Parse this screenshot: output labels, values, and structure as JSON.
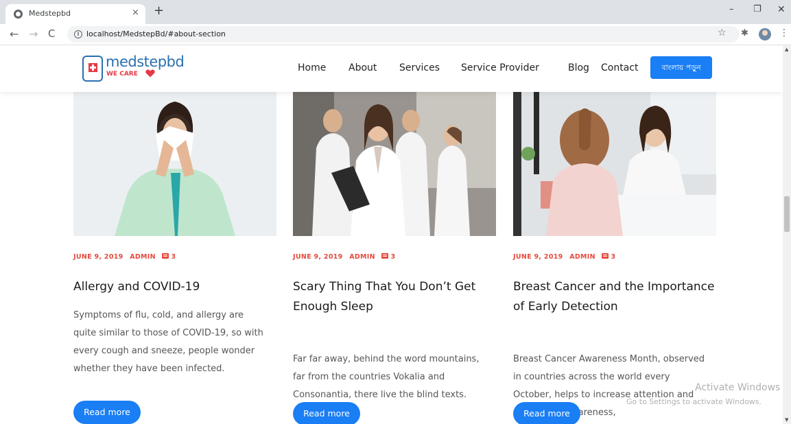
{
  "browser": {
    "tab_title": "Medstepbd",
    "tab_close": "×",
    "new_tab": "+",
    "window_minimize": "–",
    "window_maximize": "❐",
    "window_close": "✕",
    "back": "←",
    "forward": "→",
    "reload": "C",
    "info": "i",
    "url": "localhost/MedstepBd/#about-section",
    "bookmark": "☆",
    "extensions": "✱",
    "menu": "⋮",
    "scroll_up": "▲",
    "scroll_down": "▼"
  },
  "header": {
    "logo_text": "medstepbd",
    "logo_tagline": "WE CARE",
    "nav": [
      "Home",
      "About",
      "Services",
      "Service Provider",
      "Blog",
      "Contact"
    ],
    "bangla_button": "বাংলায় পড়ুন"
  },
  "posts": [
    {
      "date": "JUNE 9, 2019",
      "author": "ADMIN",
      "comments": "3",
      "title": "Allergy and COVID-19",
      "excerpt": "Symptoms of flu, cold, and allergy are quite similar to those of COVID-19, so with every cough and sneeze, people wonder whether they have been infected.",
      "button": "Read more"
    },
    {
      "date": "JUNE 9, 2019",
      "author": "ADMIN",
      "comments": "3",
      "title": "Scary Thing That You Don’t Get Enough Sleep",
      "excerpt": "Far far away, behind the word mountains, far from the countries Vokalia and Consonantia, there live the blind texts.",
      "button": "Read more"
    },
    {
      "date": "JUNE 9, 2019",
      "author": "ADMIN",
      "comments": "3",
      "title": "Breast Cancer and the Importance of Early Detection",
      "excerpt": "Breast Cancer Awareness Month, observed in countries across the world every October, helps to increase attention and support for awareness,",
      "button": "Read more"
    }
  ],
  "watermark": {
    "title": "Activate Windows",
    "subtitle": "Go to Settings to activate Windows."
  },
  "colors": {
    "accent_blue": "#1a7ef5",
    "meta_red": "#e64a3c",
    "logo_blue": "#2a6fb0",
    "logo_red": "#e53946"
  },
  "icons": {
    "tab_favicon": "globe-icon",
    "info": "info-icon",
    "comment": "comment-icon",
    "heart": "heart-icon",
    "medical_cross": "medical-cross-icon"
  }
}
